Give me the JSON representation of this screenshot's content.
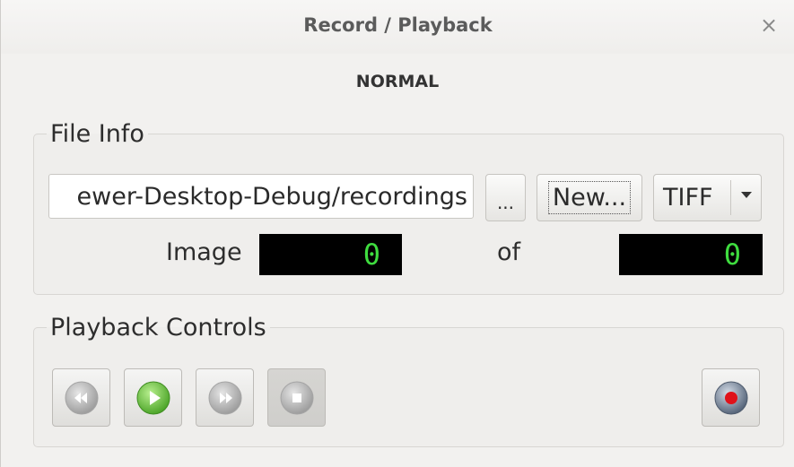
{
  "window": {
    "title": "Record / Playback",
    "close_glyph": "×"
  },
  "mode": "NORMAL",
  "file_info": {
    "legend": "File Info",
    "path_value": "ewer-Desktop-Debug/recordings",
    "browse_label": "...",
    "new_label": "New...",
    "format_selected": "TIFF",
    "image_label": "Image",
    "of_label": "of",
    "current_image": "0",
    "total_images": "0"
  },
  "playback": {
    "legend": "Playback Controls",
    "buttons": [
      {
        "name": "rewind",
        "icon": "rewind-icon"
      },
      {
        "name": "play",
        "icon": "play-icon"
      },
      {
        "name": "fast-forward",
        "icon": "fast-forward-icon"
      },
      {
        "name": "stop",
        "icon": "stop-icon"
      },
      {
        "name": "record",
        "icon": "record-icon"
      }
    ]
  },
  "colors": {
    "lcd_background": "#000000",
    "lcd_digits": "#3fdc3f",
    "play_green": "#5cb832",
    "record_red": "#e0121a",
    "disabled_gray": "#b9b9b9"
  }
}
